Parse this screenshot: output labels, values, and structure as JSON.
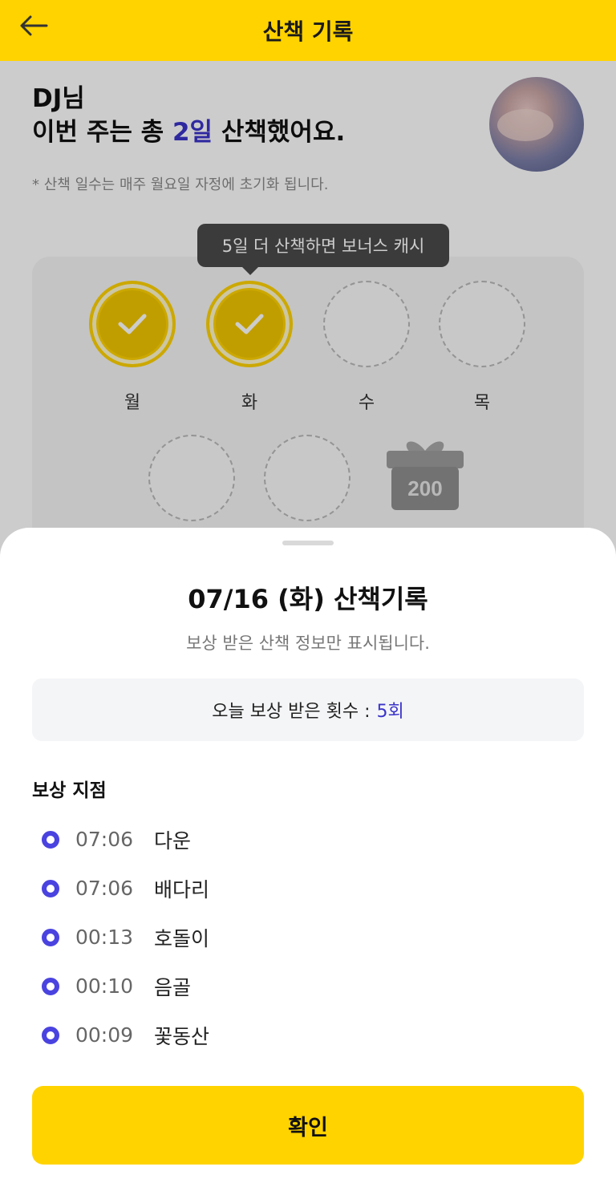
{
  "header": {
    "title": "산책 기록"
  },
  "summary": {
    "user_line": "DJ님",
    "line_prefix": "이번 주는 총 ",
    "days_count": "2일",
    "line_suffix": " 산책했어요.",
    "note": "* 산책 일수는 매주 월요일 자정에 초기화 됩니다."
  },
  "tooltip": "5일 더 산책하면 보너스 캐시",
  "days": [
    {
      "label": "월",
      "done": true
    },
    {
      "label": "화",
      "done": true
    },
    {
      "label": "수",
      "done": false
    },
    {
      "label": "목",
      "done": false
    },
    {
      "label": "",
      "done": false
    },
    {
      "label": "",
      "done": false
    }
  ],
  "gift": {
    "value": "200"
  },
  "sheet": {
    "title": "07/16 (화) 산책기록",
    "subtitle": "보상 받은 산책 정보만 표시됩니다.",
    "count_label": "오늘 보상 받은 횟수 :",
    "count_value": "5회",
    "points_title": "보상 지점",
    "points": [
      {
        "time": "07:06",
        "place": "다운"
      },
      {
        "time": "07:06",
        "place": "배다리"
      },
      {
        "time": "00:13",
        "place": "호돌이"
      },
      {
        "time": "00:10",
        "place": "음골"
      },
      {
        "time": "00:09",
        "place": "꽃동산"
      }
    ],
    "confirm_label": "확인"
  },
  "colors": {
    "brand": "#ffd300",
    "accent": "#3b34c9",
    "dot": "#4a43e0"
  }
}
